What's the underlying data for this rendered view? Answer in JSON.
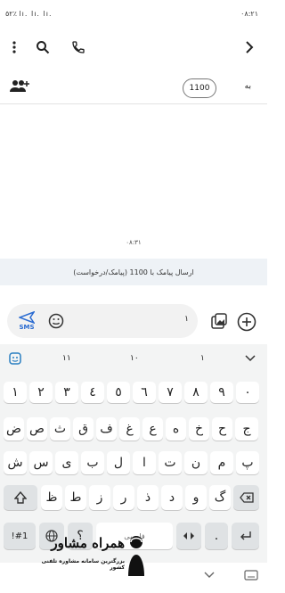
{
  "status_bar": {
    "left": "٥٢٪ lı. lı. lı.",
    "right": "٠٨:٢١"
  },
  "recipient": {
    "to_label": "به",
    "number": "1100"
  },
  "conversation": {
    "timestamp": "٠٨:٣١"
  },
  "banner": {
    "text": "ارسال پیامک با 1100 (پیامک/درخواست)"
  },
  "composer": {
    "char_count": "١",
    "send_label": "SMS"
  },
  "suggestions": [
    "١١",
    "١٠",
    "١"
  ],
  "keyboard": {
    "row_numbers": [
      "١",
      "٢",
      "٣",
      "٤",
      "٥",
      "٦",
      "٧",
      "٨",
      "٩",
      "٠"
    ],
    "row1": [
      "ض",
      "ص",
      "ث",
      "ق",
      "ف",
      "غ",
      "ع",
      "ه",
      "خ",
      "ح",
      "ج"
    ],
    "row2": [
      "ش",
      "س",
      "ی",
      "ب",
      "ل",
      "ا",
      "ت",
      "ن",
      "م",
      "پ"
    ],
    "row3": [
      "ظ",
      "ط",
      "ز",
      "ر",
      "ذ",
      "د",
      "و",
      "گ"
    ],
    "lang_label": "فارسی",
    "symbols_label": "!#1",
    "comma": "،",
    "question": "؟",
    "period": "."
  },
  "watermark": {
    "title": "همراه مشاور",
    "subtitle": "بزرگترین سامانه مشاوره تلفنی کشور"
  }
}
